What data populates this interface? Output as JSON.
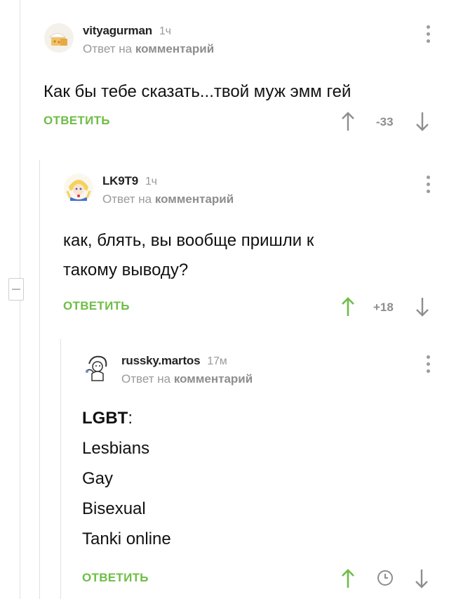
{
  "comments": [
    {
      "username": "vityagurman",
      "time": "1ч",
      "reply_prefix": "Ответ на",
      "reply_target": "комментарий",
      "text": "Как бы тебе сказать...твой муж эмм гей",
      "reply_label": "ОТВЕТИТЬ",
      "score": "-33"
    },
    {
      "username": "LK9T9",
      "time": "1ч",
      "reply_prefix": "Ответ на",
      "reply_target": "комментарий",
      "text_lines": [
        "как, блять, вы вообще пришли к",
        "такому выводу?"
      ],
      "reply_label": "ОТВЕТИТЬ",
      "score": "+18"
    },
    {
      "username": "russky.martos",
      "time": "17м",
      "reply_prefix": "Ответ на",
      "reply_target": "комментарий",
      "list_title": "LGBT",
      "list_colon": ":",
      "list_items": [
        "Lesbians",
        "Gay",
        "Bisexual",
        "Tanki online"
      ],
      "reply_label": "ОТВЕТИТЬ"
    }
  ],
  "colors": {
    "accent_green": "#6ebd46",
    "muted_gray": "#9a9a9a",
    "thread_line": "#e0e0e0"
  },
  "icons": {
    "up": "arrow-up-icon",
    "down": "arrow-down-icon",
    "more": "more-vertical-icon",
    "clock": "clock-icon",
    "collapse": "minus-icon"
  }
}
